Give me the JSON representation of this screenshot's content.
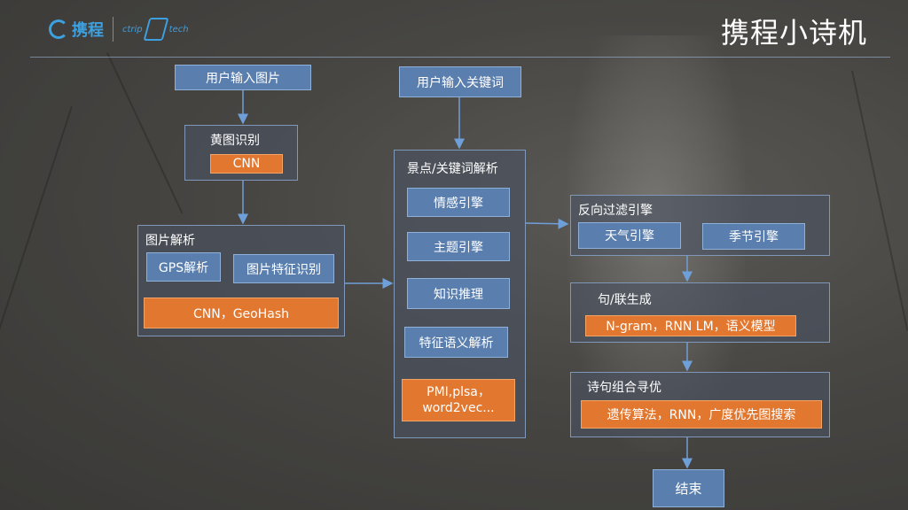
{
  "header": {
    "title": "携程小诗机",
    "logo_text": "携程",
    "tech_logo_left": "ctrip",
    "tech_logo_right": "tech"
  },
  "nodes": {
    "user_image": "用户输入图片",
    "user_keyword": "用户输入关键词",
    "porn_detect": "黄图识别",
    "porn_cnn": "CNN",
    "image_parse": "图片解析",
    "gps_parse": "GPS解析",
    "image_feature": "图片特征识别",
    "image_algo": "CNN，GeoHash",
    "keyword_parse": "景点/关键词解析",
    "emotion_engine": "情感引擎",
    "topic_engine": "主题引擎",
    "knowledge_reasoning": "知识推理",
    "semantic_parse": "特征语义解析",
    "keyword_algo": "PMI,plsa，word2vec...",
    "reverse_filter": "反向过滤引擎",
    "weather_engine": "天气引擎",
    "season_engine": "季节引擎",
    "couplet_gen": "句/联生成",
    "couplet_algo": "N-gram，RNN LM，语义模型",
    "poem_optimize": "诗句组合寻优",
    "poem_algo": "遗传算法，RNN，广度优先图搜索",
    "end": "结束"
  },
  "colors": {
    "blue_box": "#5a7fae",
    "orange_box": "#e2772f",
    "arrow": "#6f9fd8",
    "accent": "#3da0e0"
  }
}
